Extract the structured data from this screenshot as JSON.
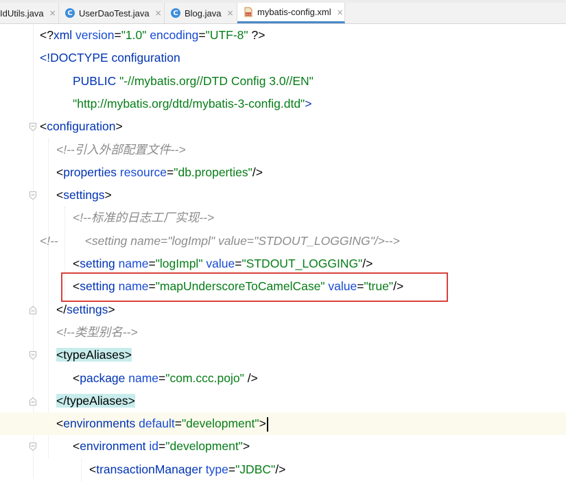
{
  "tabs": [
    {
      "label": "IdUtils.java",
      "icon": "java-class-icon",
      "active": false
    },
    {
      "label": "UserDaoTest.java",
      "icon": "java-class-icon",
      "active": false
    },
    {
      "label": "Blog.java",
      "icon": "java-class-icon",
      "active": false
    },
    {
      "label": "mybatis-config.xml",
      "icon": "xml-file-icon",
      "active": true
    }
  ],
  "tab_close_glyph": "×",
  "colors": {
    "tag": "#0033b3",
    "attribute": "#174ad4",
    "value": "#067d17",
    "comment": "#8c8c8c",
    "tag_highlight": "#c8ecec",
    "current_line": "#fcfaed",
    "annotation_box": "#d9403b"
  },
  "code": {
    "lines": [
      {
        "indent": 58,
        "segments": [
          {
            "s": "b",
            "t": "<?"
          },
          {
            "s": "t",
            "t": "xml "
          },
          {
            "s": "a",
            "t": "version"
          },
          {
            "s": "b",
            "t": "="
          },
          {
            "s": "v",
            "t": "\"1.0\""
          },
          {
            "s": "b",
            "t": " "
          },
          {
            "s": "a",
            "t": "encoding"
          },
          {
            "s": "b",
            "t": "="
          },
          {
            "s": "v",
            "t": "\"UTF-8\""
          },
          {
            "s": "b",
            "t": " ?>"
          }
        ]
      },
      {
        "indent": 58,
        "segments": [
          {
            "s": "t",
            "t": "<!DOCTYPE configuration"
          }
        ]
      },
      {
        "indent": 106,
        "segments": [
          {
            "s": "t",
            "t": "PUBLIC "
          },
          {
            "s": "v",
            "t": "\"-//mybatis.org//DTD Config 3.0//EN\""
          }
        ]
      },
      {
        "indent": 106,
        "segments": [
          {
            "s": "v",
            "t": "\"http://mybatis.org/dtd/mybatis-3-config.dtd\""
          },
          {
            "s": "t",
            "t": ">"
          }
        ]
      },
      {
        "indent": 58,
        "fold": "open",
        "segments": [
          {
            "s": "b",
            "t": "<"
          },
          {
            "s": "t",
            "t": "configuration"
          },
          {
            "s": "b",
            "t": ">"
          }
        ]
      },
      {
        "indent": 82,
        "segments": [
          {
            "s": "c",
            "t": "<!--引入外部配置文件-->"
          }
        ]
      },
      {
        "indent": 82,
        "segments": [
          {
            "s": "b",
            "t": "<"
          },
          {
            "s": "t",
            "t": "properties "
          },
          {
            "s": "a",
            "t": "resource"
          },
          {
            "s": "b",
            "t": "="
          },
          {
            "s": "v",
            "t": "\"db.properties\""
          },
          {
            "s": "b",
            "t": "/>"
          }
        ]
      },
      {
        "indent": 82,
        "fold": "open",
        "segments": [
          {
            "s": "b",
            "t": "<"
          },
          {
            "s": "t",
            "t": "settings"
          },
          {
            "s": "b",
            "t": ">"
          }
        ]
      },
      {
        "indent": 106,
        "segments": [
          {
            "s": "c",
            "t": "<!--标准的日志工厂实现-->"
          }
        ]
      },
      {
        "indent": 58,
        "segments": [
          {
            "s": "c",
            "t": "<!--        <setting name=\"logImpl\" value=\"STDOUT_LOGGING\"/>-->"
          }
        ]
      },
      {
        "indent": 106,
        "segments": [
          {
            "s": "b",
            "t": "<"
          },
          {
            "s": "t",
            "t": "setting "
          },
          {
            "s": "a",
            "t": "name"
          },
          {
            "s": "b",
            "t": "="
          },
          {
            "s": "v",
            "t": "\"logImpl\""
          },
          {
            "s": "b",
            "t": " "
          },
          {
            "s": "a",
            "t": "value"
          },
          {
            "s": "b",
            "t": "="
          },
          {
            "s": "v",
            "t": "\"STDOUT_LOGGING\""
          },
          {
            "s": "b",
            "t": "/>"
          }
        ]
      },
      {
        "indent": 106,
        "segments": [
          {
            "s": "b",
            "t": "<"
          },
          {
            "s": "t",
            "t": "setting "
          },
          {
            "s": "a",
            "t": "name"
          },
          {
            "s": "b",
            "t": "="
          },
          {
            "s": "v",
            "t": "\"mapUnderscoreToCamelCase\""
          },
          {
            "s": "b",
            "t": " "
          },
          {
            "s": "a",
            "t": "value"
          },
          {
            "s": "b",
            "t": "="
          },
          {
            "s": "v",
            "t": "\"true\""
          },
          {
            "s": "b",
            "t": "/>"
          }
        ]
      },
      {
        "indent": 82,
        "fold": "close",
        "segments": [
          {
            "s": "b",
            "t": "</"
          },
          {
            "s": "t",
            "t": "settings"
          },
          {
            "s": "b",
            "t": ">"
          }
        ]
      },
      {
        "indent": 82,
        "segments": [
          {
            "s": "c",
            "t": "<!--类型别名-->"
          }
        ]
      },
      {
        "indent": 82,
        "fold": "open",
        "segments": [
          {
            "s": "hl",
            "t": "<typeAliases>"
          }
        ]
      },
      {
        "indent": 106,
        "segments": [
          {
            "s": "b",
            "t": "<"
          },
          {
            "s": "t",
            "t": "package "
          },
          {
            "s": "a",
            "t": "name"
          },
          {
            "s": "b",
            "t": "="
          },
          {
            "s": "v",
            "t": "\"com.ccc.pojo\""
          },
          {
            "s": "b",
            "t": " />"
          }
        ]
      },
      {
        "indent": 82,
        "fold": "close",
        "segments": [
          {
            "s": "hl",
            "t": "</typeAliases>"
          }
        ]
      },
      {
        "indent": 82,
        "current": true,
        "caret": true,
        "segments": [
          {
            "s": "b",
            "t": "<"
          },
          {
            "s": "t",
            "t": "environments "
          },
          {
            "s": "a",
            "t": "default"
          },
          {
            "s": "b",
            "t": "="
          },
          {
            "s": "v",
            "t": "\"development\""
          },
          {
            "s": "b",
            "t": ">"
          }
        ]
      },
      {
        "indent": 106,
        "fold": "open",
        "segments": [
          {
            "s": "b",
            "t": "<"
          },
          {
            "s": "t",
            "t": "environment "
          },
          {
            "s": "a",
            "t": "id"
          },
          {
            "s": "b",
            "t": "="
          },
          {
            "s": "v",
            "t": "\"development\""
          },
          {
            "s": "b",
            "t": ">"
          }
        ]
      },
      {
        "indent": 130,
        "segments": [
          {
            "s": "b",
            "t": "<"
          },
          {
            "s": "t",
            "t": "transactionManager "
          },
          {
            "s": "a",
            "t": "type"
          },
          {
            "s": "b",
            "t": "="
          },
          {
            "s": "v",
            "t": "\"JDBC\""
          },
          {
            "s": "b",
            "t": "/>"
          }
        ]
      }
    ]
  },
  "highlight_box": {
    "line": 11,
    "label": "annotation"
  }
}
